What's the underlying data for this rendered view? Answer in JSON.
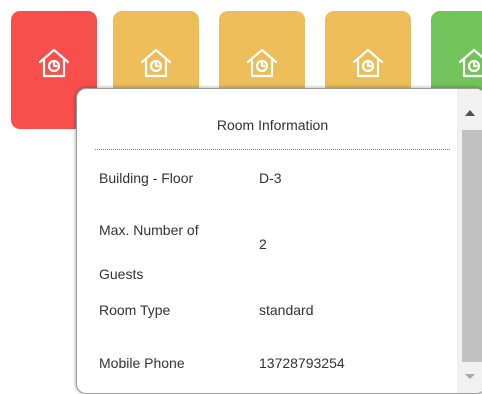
{
  "room_tiles": [
    {
      "color": "#f84f4c",
      "icon": "house-clock-icon"
    },
    {
      "color": "#ecbd58",
      "icon": "house-clock-icon"
    },
    {
      "color": "#ecbd58",
      "icon": "house-clock-icon"
    },
    {
      "color": "#ecbd58",
      "icon": "house-clock-icon"
    },
    {
      "color": "#72c35a",
      "icon": "house-clock-icon"
    }
  ],
  "popup": {
    "title": "Room Information",
    "rows": [
      {
        "label": "Building - Floor",
        "value": "D-3"
      },
      {
        "label": "Max. Number of Guests",
        "value": "2"
      },
      {
        "label": "Room Type",
        "value": "standard"
      },
      {
        "label": "Mobile Phone",
        "value": "13728793254"
      }
    ]
  }
}
